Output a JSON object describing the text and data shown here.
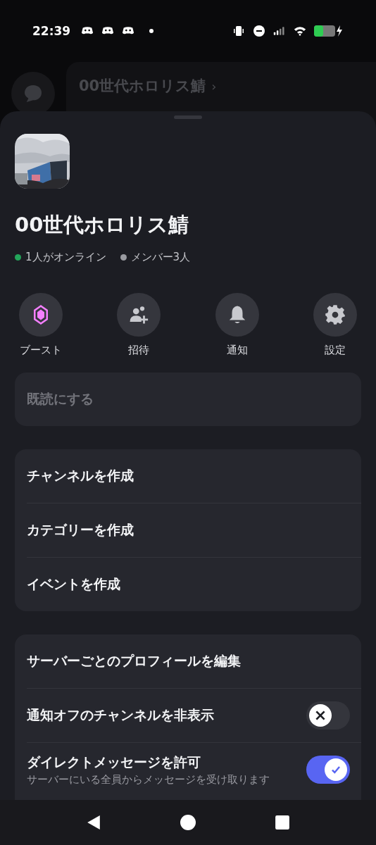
{
  "status_bar": {
    "time": "22:39"
  },
  "background": {
    "title": "00世代ホロリス鯖",
    "chevron": "›"
  },
  "server": {
    "name": "00世代ホロリス鯖",
    "online": "1人がオンライン",
    "members": "メンバー3人"
  },
  "actions": [
    {
      "kind": "boost",
      "label": "ブースト"
    },
    {
      "kind": "invite",
      "label": "招待"
    },
    {
      "kind": "notify",
      "label": "通知"
    },
    {
      "kind": "settings",
      "label": "設定"
    }
  ],
  "groups": [
    [
      {
        "kind": "link",
        "label": "既読にする",
        "disabled": true
      }
    ],
    [
      {
        "kind": "link",
        "label": "チャンネルを作成",
        "disabled": false
      },
      {
        "kind": "link",
        "label": "カテゴリーを作成",
        "disabled": false
      },
      {
        "kind": "link",
        "label": "イベントを作成",
        "disabled": false
      }
    ],
    [
      {
        "kind": "link",
        "label": "サーバーごとのプロフィールを編集",
        "disabled": false
      },
      {
        "kind": "toggle",
        "label": "通知オフのチャンネルを非表示",
        "on": false,
        "disabled": false
      },
      {
        "kind": "toggle",
        "label": "ダイレクトメッセージを許可",
        "description": "サーバーにいる全員からメッセージを受け取ります",
        "on": true,
        "disabled": false
      }
    ]
  ]
}
